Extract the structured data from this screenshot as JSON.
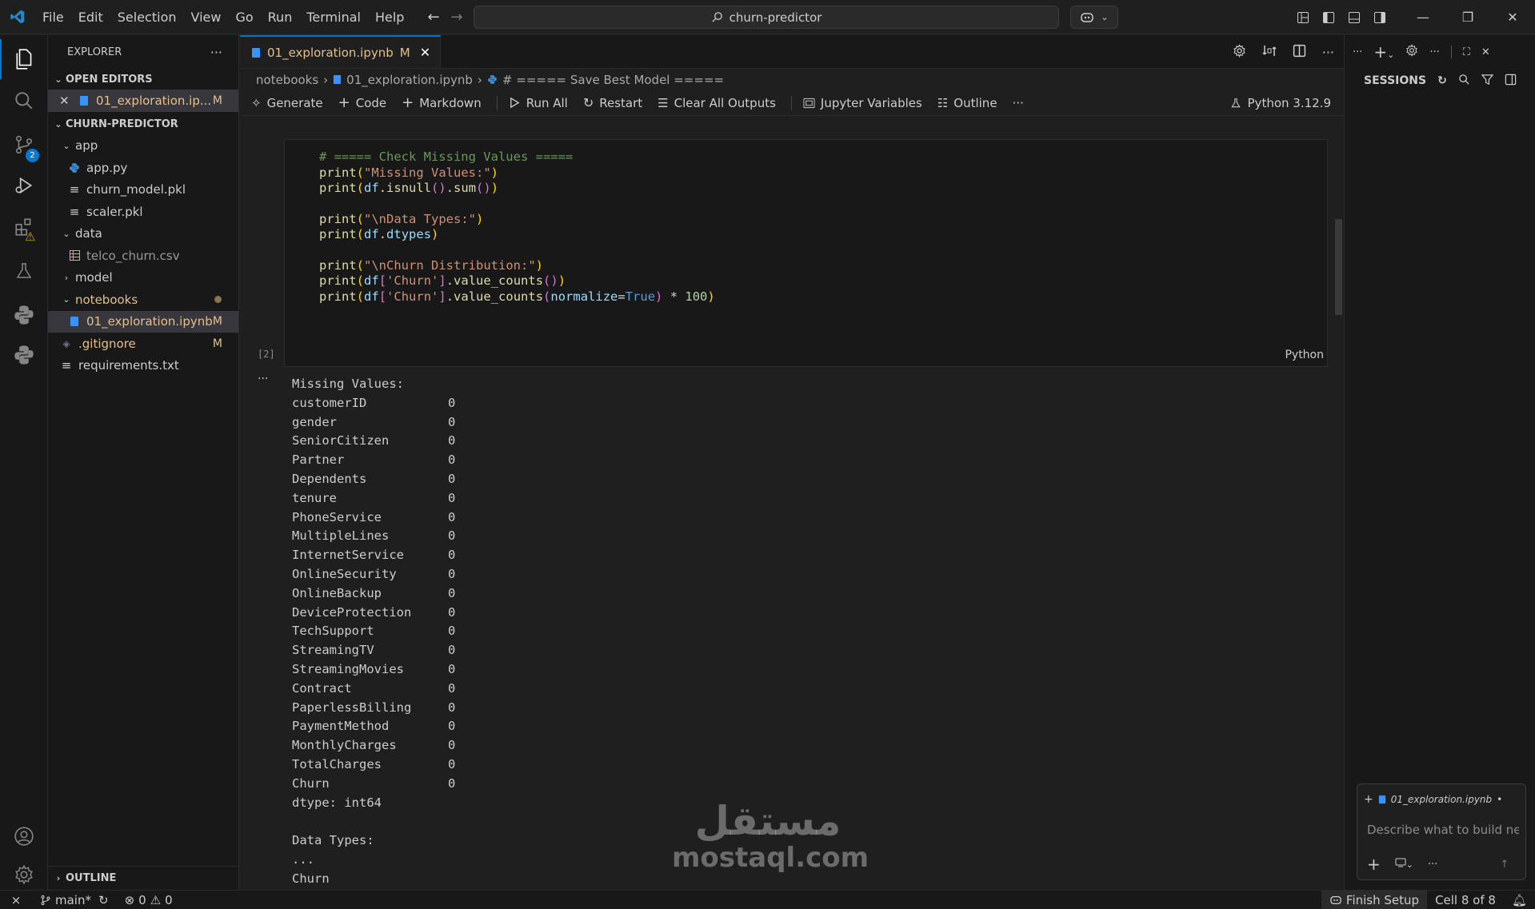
{
  "menu": [
    "File",
    "Edit",
    "Selection",
    "View",
    "Go",
    "Run",
    "Terminal",
    "Help"
  ],
  "command_center": {
    "text": "churn-predictor"
  },
  "explorer": {
    "title": "EXPLORER",
    "open_editors_label": "OPEN EDITORS",
    "open_editor": {
      "name": "01_exploration.ip...",
      "status": "M"
    },
    "project_label": "CHURN-PREDICTOR",
    "tree": [
      {
        "label": "app",
        "type": "folder"
      },
      {
        "label": "app.py",
        "type": "py"
      },
      {
        "label": "churn_model.pkl",
        "type": "file"
      },
      {
        "label": "scaler.pkl",
        "type": "file"
      },
      {
        "label": "data",
        "type": "folder"
      },
      {
        "label": "telco_churn.csv",
        "type": "csv"
      },
      {
        "label": "model",
        "type": "folder"
      },
      {
        "label": "notebooks",
        "type": "folder"
      },
      {
        "label": "01_exploration.ipynb",
        "type": "nb",
        "status": "M"
      },
      {
        "label": ".gitignore",
        "type": "git",
        "status": "M"
      },
      {
        "label": "requirements.txt",
        "type": "txt"
      }
    ],
    "outline_label": "OUTLINE"
  },
  "activity": {
    "source_control_badge": "2"
  },
  "editor": {
    "tab_label": "01_exploration.ipynb",
    "tab_status": "M",
    "breadcrumb": [
      "notebooks",
      "01_exploration.ipynb",
      "# ===== Save Best Model ====="
    ],
    "toolbar": {
      "generate": "Generate",
      "code": "Code",
      "markdown": "Markdown",
      "run_all": "Run All",
      "restart": "Restart",
      "clear_outputs": "Clear All Outputs",
      "variables": "Jupyter Variables",
      "outline": "Outline",
      "kernel": "Python 3.12.9"
    },
    "cell": {
      "execution_count": "[2]",
      "language": "Python",
      "output_more": "..."
    },
    "output": {
      "header": "Missing Values:",
      "rows": [
        [
          "customerID",
          "0"
        ],
        [
          "gender",
          "0"
        ],
        [
          "SeniorCitizen",
          "0"
        ],
        [
          "Partner",
          "0"
        ],
        [
          "Dependents",
          "0"
        ],
        [
          "tenure",
          "0"
        ],
        [
          "PhoneService",
          "0"
        ],
        [
          "MultipleLines",
          "0"
        ],
        [
          "InternetService",
          "0"
        ],
        [
          "OnlineSecurity",
          "0"
        ],
        [
          "OnlineBackup",
          "0"
        ],
        [
          "DeviceProtection",
          "0"
        ],
        [
          "TechSupport",
          "0"
        ],
        [
          "StreamingTV",
          "0"
        ],
        [
          "StreamingMovies",
          "0"
        ],
        [
          "Contract",
          "0"
        ],
        [
          "PaperlessBilling",
          "0"
        ],
        [
          "PaymentMethod",
          "0"
        ],
        [
          "MonthlyCharges",
          "0"
        ],
        [
          "TotalCharges",
          "0"
        ],
        [
          "Churn",
          "0"
        ]
      ],
      "dtype": "dtype: int64",
      "data_types": "Data Types:",
      "ellipsis": "...",
      "last": "Churn"
    },
    "watermark": {
      "arabic": "مستقل",
      "latin": "mostaql.com"
    }
  },
  "right_panel": {
    "sessions_label": "SESSIONS",
    "chat_chip": "01_exploration.ipynb",
    "chat_placeholder": "Describe what to build ne"
  },
  "statusbar": {
    "branch": "main*",
    "errors": "0",
    "warnings": "0",
    "finish_setup": "Finish Setup",
    "cell_pos": "Cell 8 of 8"
  },
  "colors": {
    "accent": "#0078d4",
    "modified": "#e2c08d",
    "bg": "#1f1f1f",
    "sidebar": "#181818"
  }
}
